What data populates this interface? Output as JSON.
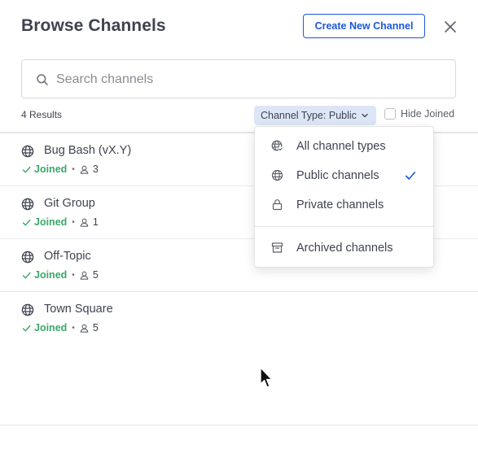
{
  "modal": {
    "title": "Browse Channels",
    "create_label": "Create New Channel"
  },
  "search": {
    "placeholder": "Search channels",
    "value": ""
  },
  "filters": {
    "results_text": "4 Results",
    "channel_type_label": "Channel Type: Public",
    "hide_joined_label": "Hide Joined",
    "hide_joined_checked": false
  },
  "channels": [
    {
      "name": "Bug Bash (vX.Y)",
      "status": "Joined",
      "members": "3"
    },
    {
      "name": "Git Group",
      "status": "Joined",
      "members": "1"
    },
    {
      "name": "Off-Topic",
      "status": "Joined",
      "members": "5"
    },
    {
      "name": "Town Square",
      "status": "Joined",
      "members": "5"
    }
  ],
  "type_menu": {
    "items": [
      {
        "label": "All channel types",
        "icon": "globe-check-icon",
        "selected": false
      },
      {
        "label": "Public channels",
        "icon": "globe-icon",
        "selected": true
      },
      {
        "label": "Private channels",
        "icon": "lock-icon",
        "selected": false
      },
      {
        "label": "Archived channels",
        "icon": "archive-icon",
        "selected": false
      }
    ]
  },
  "colors": {
    "accent": "#1c58d9",
    "joined_green": "#3aa76a",
    "filter_chip_bg": "#dde6f7",
    "text": "#3f4350"
  }
}
